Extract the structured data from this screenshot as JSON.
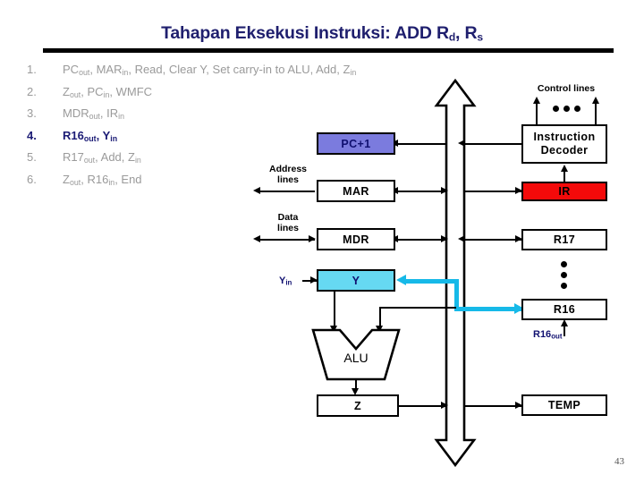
{
  "slide": {
    "title_main": "Tahapan Eksekusi Instruksi: ADD R",
    "title_sub1": "d",
    "title_mid": ", R",
    "title_sub2": "s",
    "page_number": "43"
  },
  "steps": [
    {
      "num": "1.",
      "text": "PC",
      "s1": "out",
      "t2": ", MAR",
      "s2": "in",
      "t3": ", Read, Clear Y, Set carry-in to ALU, Add, Z",
      "s3": "in",
      "t4": "",
      "active": false
    },
    {
      "num": "2.",
      "text": "Z",
      "s1": "out",
      "t2": ", PC",
      "s2": "in",
      "t3": ", WMFC",
      "s3": "",
      "t4": "",
      "active": false
    },
    {
      "num": "3.",
      "text": "MDR",
      "s1": "out",
      "t2": ", IR",
      "s2": "in",
      "t3": "",
      "s3": "",
      "t4": "",
      "active": false
    },
    {
      "num": "4.",
      "text": "R16",
      "s1": "out",
      "t2": ", Y",
      "s2": "in",
      "t3": "",
      "s3": "",
      "t4": "",
      "active": true
    },
    {
      "num": "5.",
      "text": "R17",
      "s1": "out",
      "t2": ", Add, Z",
      "s2": "in",
      "t3": "",
      "s3": "",
      "t4": "",
      "active": false
    },
    {
      "num": "6.",
      "text": "Z",
      "s1": "out",
      "t2": ", R16",
      "s2": "in",
      "t3": ", End",
      "s3": "",
      "t4": "",
      "active": false
    }
  ],
  "diagram": {
    "boxes": {
      "pc": "PC+1",
      "mar": "MAR",
      "mdr": "MDR",
      "y": "Y",
      "alu": "ALU",
      "z": "Z",
      "decoder_line1": "Instruction",
      "decoder_line2": "Decoder",
      "ir": "IR",
      "r17": "R17",
      "r16": "R16",
      "temp": "TEMP"
    },
    "labels": {
      "control_lines": "Control lines",
      "address_lines_1": "Address",
      "address_lines_2": "lines",
      "data_lines_1": "Data",
      "data_lines_2": "lines",
      "y_in": "Y",
      "y_in_sub": "in",
      "r16_out": "R16",
      "r16_out_sub": "out"
    }
  },
  "colors": {
    "title": "#1F1F6E",
    "active_step": "#1B1B75",
    "inactive_step": "#9A9A9A",
    "pc_box": "#7B7BDE",
    "y_box": "#66D9F2",
    "ir_box": "#F40A0A",
    "highlight_path": "#16B9E8",
    "line": "#000000"
  }
}
